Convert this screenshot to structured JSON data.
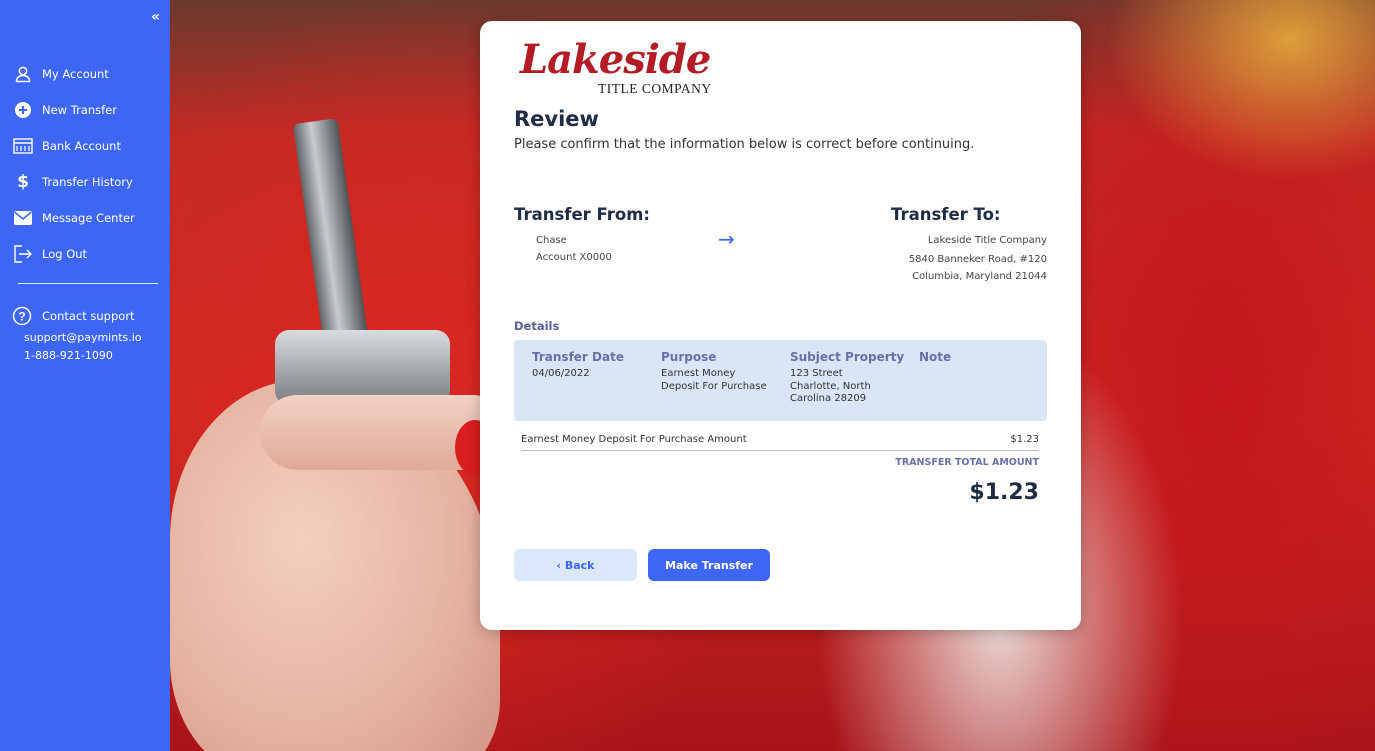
{
  "sidebar": {
    "collapse_icon": "«",
    "items": [
      {
        "label": "My Account",
        "icon": "user-icon"
      },
      {
        "label": "New Transfer",
        "icon": "plus-circle-icon"
      },
      {
        "label": "Bank Account",
        "icon": "bank-icon"
      },
      {
        "label": "Transfer History",
        "icon": "dollar-icon"
      },
      {
        "label": "Message Center",
        "icon": "envelope-icon"
      },
      {
        "label": "Log Out",
        "icon": "logout-icon"
      }
    ],
    "support": {
      "label": "Contact support",
      "email": "support@paymints.io",
      "phone": "1-888-921-1090"
    },
    "colors": {
      "background": "#3e66f5"
    }
  },
  "card": {
    "logo": {
      "script": "Lakeside",
      "sub": "TITLE COMPANY"
    },
    "title": "Review",
    "subtitle": "Please confirm that the information below is correct before continuing.",
    "from": {
      "heading": "Transfer From:",
      "line1": "Chase",
      "line2": "Account X0000"
    },
    "arrow": "→",
    "to": {
      "heading": "Transfer To:",
      "line1": "Lakeside Title Company",
      "line2": "5840 Banneker Road, #120",
      "line3": "Columbia, Maryland 21044"
    },
    "details": {
      "heading": "Details",
      "columns": [
        {
          "header": "Transfer Date",
          "value": "04/06/2022"
        },
        {
          "header": "Purpose",
          "value": "Earnest Money Deposit For Purchase"
        },
        {
          "header": "Subject Property",
          "value": "123 Street Charlotte, North Carolina 28209"
        },
        {
          "header": "Note",
          "value": ""
        }
      ]
    },
    "line_item": {
      "label": "Earnest Money Deposit For Purchase Amount",
      "amount": "$1.23"
    },
    "total": {
      "label": "TRANSFER TOTAL AMOUNT",
      "amount": "$1.23"
    },
    "buttons": {
      "back": "‹ Back",
      "make": "Make Transfer"
    }
  },
  "colors": {
    "accent": "#3e66f5",
    "brand_red": "#b31c24",
    "details_bg": "#dae6f7"
  }
}
